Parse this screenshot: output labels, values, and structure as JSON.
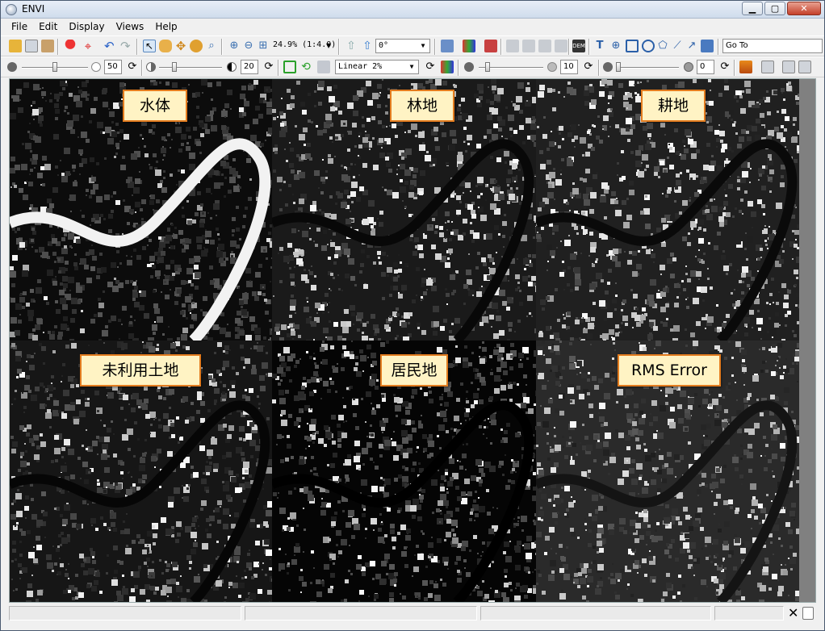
{
  "window": {
    "title": "ENVI"
  },
  "menu": [
    "File",
    "Edit",
    "Display",
    "Views",
    "Help"
  ],
  "toolbar1": {
    "zoom_text": "24.9% (1:4.0)",
    "rotation_value": "0°",
    "goto_placeholder": "Go To"
  },
  "toolbar2": {
    "brightness_value": "50",
    "contrast_value": "20",
    "stretch_value": "Linear 2%",
    "sharpen_value": "10",
    "transparency_value": "0"
  },
  "panels": [
    {
      "label": "水体",
      "active": true
    },
    {
      "label": "林地",
      "active": false
    },
    {
      "label": "耕地",
      "active": false
    },
    {
      "label": "未利用土地",
      "active": false
    },
    {
      "label": "居民地",
      "active": false
    },
    {
      "label": "RMS Error",
      "active": false
    }
  ]
}
